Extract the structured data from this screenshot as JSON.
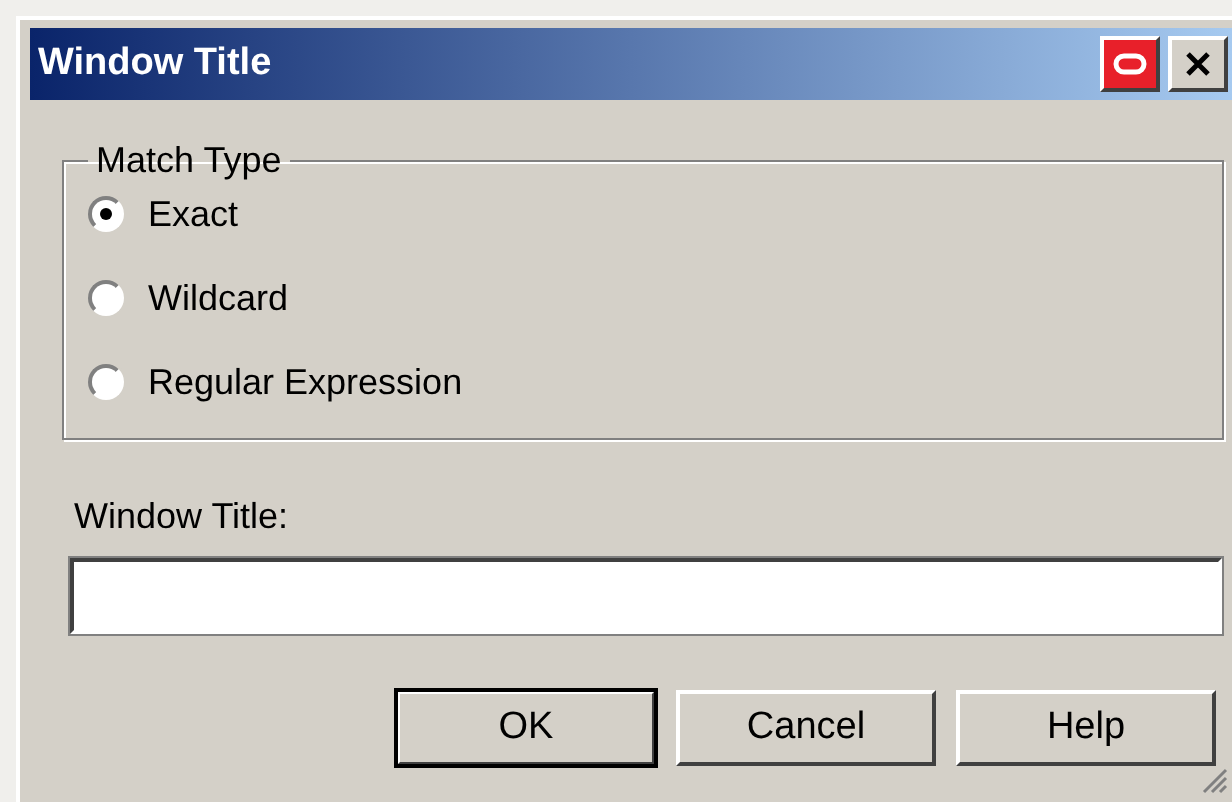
{
  "window": {
    "title": "Window Title"
  },
  "match_type": {
    "label": "Match Type",
    "options": [
      {
        "label": "Exact",
        "selected": true
      },
      {
        "label": "Wildcard",
        "selected": false
      },
      {
        "label": "Regular Expression",
        "selected": false
      }
    ]
  },
  "title_field": {
    "label": "Window Title:"
  },
  "buttons": [
    {
      "label": "OK",
      "default": true
    },
    {
      "label": "Cancel",
      "default": false
    },
    {
      "label": "Help",
      "default": false
    }
  ]
}
